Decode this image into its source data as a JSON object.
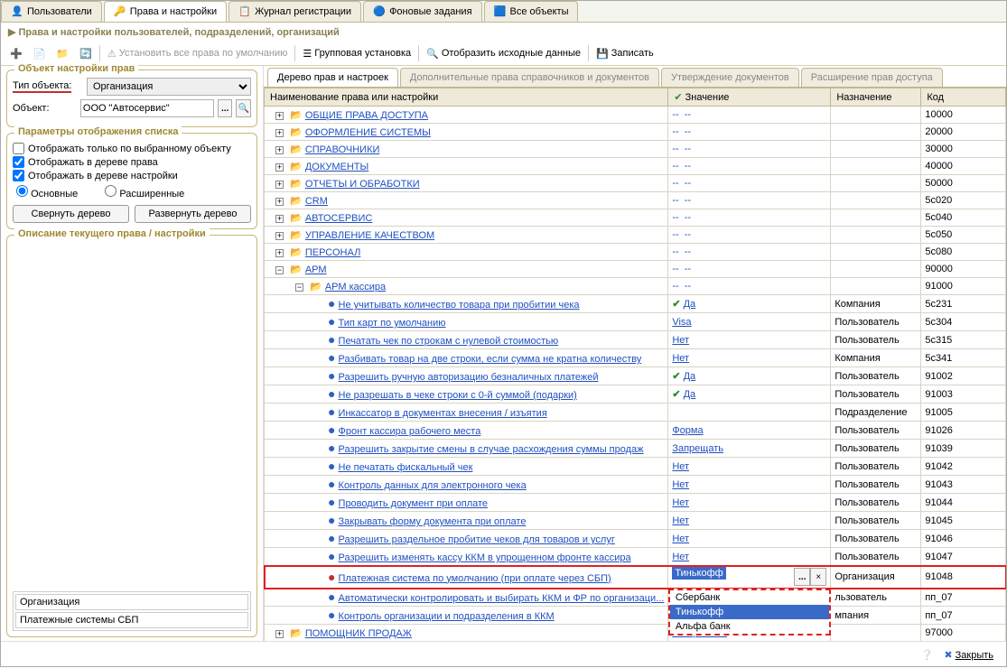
{
  "top_tabs": {
    "users": "Пользователи",
    "rights": "Права и настройки",
    "log": "Журнал регистрации",
    "jobs": "Фоновые задания",
    "all": "Все объекты"
  },
  "breadcrumb": "Права и настройки пользователей, подразделений, организаций",
  "toolbar": {
    "set_defaults": "Установить все права по умолчанию",
    "group_set": "Групповая установка",
    "show_source": "Отобразить исходные данные",
    "save": "Записать"
  },
  "left": {
    "section1_title": "Объект настройки прав",
    "type_label": "Тип объекта:",
    "type_value": "Организация",
    "object_label": "Объект:",
    "object_value": "ООО \"Автосервис\"",
    "section2_title": "Параметры отображения списка",
    "chk_only_selected": "Отображать только по  выбранному объекту",
    "chk_show_rights": "Отображать в дереве права",
    "chk_show_settings": "Отображать в дереве настройки",
    "radio_main": "Основные",
    "radio_ext": "Расширенные",
    "btn_collapse": "Свернуть дерево",
    "btn_expand": "Развернуть дерево",
    "section3_title": "Описание текущего права / настройки",
    "desc_col1": "Организация",
    "desc_col2": "Платежные системы СБП"
  },
  "mid_tabs": {
    "tree": "Дерево прав и настроек",
    "extra": "Дополнительные права справочников и документов",
    "approve": "Утверждение документов",
    "expand": "Расширение прав доступа"
  },
  "grid_headers": {
    "name": "Наименование права или настройки",
    "value": "Значение",
    "assign": "Назначение",
    "code": "Код"
  },
  "rows": [
    {
      "type": "folder",
      "level": 0,
      "name": "ОБЩИЕ ПРАВА ДОСТУПА",
      "val": "-- --",
      "assign": "",
      "code": "10000"
    },
    {
      "type": "folder",
      "level": 0,
      "name": "ОФОРМЛЕНИЕ СИСТЕМЫ",
      "val": "-- --",
      "assign": "",
      "code": "20000"
    },
    {
      "type": "folder",
      "level": 0,
      "name": "СПРАВОЧНИКИ",
      "val": "-- --",
      "assign": "",
      "code": "30000"
    },
    {
      "type": "folder",
      "level": 0,
      "name": "ДОКУМЕНТЫ",
      "val": "-- --",
      "assign": "",
      "code": "40000"
    },
    {
      "type": "folder",
      "level": 0,
      "name": "ОТЧЕТЫ И ОБРАБОТКИ",
      "val": "-- --",
      "assign": "",
      "code": "50000"
    },
    {
      "type": "folder",
      "level": 0,
      "name": "CRM",
      "val": "-- --",
      "assign": "",
      "code": "5с020"
    },
    {
      "type": "folder",
      "level": 0,
      "name": "АВТОСЕРВИС",
      "val": "-- --",
      "assign": "",
      "code": "5с040"
    },
    {
      "type": "folder",
      "level": 0,
      "name": "УПРАВЛЕНИЕ КАЧЕСТВОМ",
      "val": "-- --",
      "assign": "",
      "code": "5с050"
    },
    {
      "type": "folder",
      "level": 0,
      "name": "ПЕРСОНАЛ",
      "val": "-- --",
      "assign": "",
      "code": "5с080"
    },
    {
      "type": "folder",
      "level": 0,
      "name": "АРМ",
      "val": "-- --",
      "assign": "",
      "code": "90000",
      "open": true
    },
    {
      "type": "folder",
      "level": 1,
      "name": "АРМ кассира",
      "val": "-- --",
      "assign": "",
      "code": "91000",
      "open": true
    },
    {
      "type": "leaf",
      "level": 2,
      "name": "Не учитывать количество товара при пробитии чека",
      "val": "Да",
      "check": true,
      "assign": "Компания",
      "code": "5с231"
    },
    {
      "type": "leaf",
      "level": 2,
      "name": "Тип карт по умолчанию",
      "val": "Visa",
      "assign": "Пользователь",
      "code": "5с304"
    },
    {
      "type": "leaf",
      "level": 2,
      "name": "Печатать чек по строкам с нулевой стоимостью",
      "val": "Нет",
      "assign": "Пользователь",
      "code": "5с315"
    },
    {
      "type": "leaf",
      "level": 2,
      "name": "Разбивать товар на две строки, если сумма не кратна количеству",
      "val": "Нет",
      "assign": "Компания",
      "code": "5с341"
    },
    {
      "type": "leaf",
      "level": 2,
      "name": "Разрешить ручную авторизацию безналичных платежей",
      "val": "Да",
      "check": true,
      "assign": "Пользователь",
      "code": "91002"
    },
    {
      "type": "leaf",
      "level": 2,
      "name": "Не разрешать в чеке строки с 0-й суммой (подарки)",
      "val": "Да",
      "check": true,
      "assign": "Пользователь",
      "code": "91003"
    },
    {
      "type": "leaf",
      "level": 2,
      "name": "Инкассатор в документах внесения / изъятия",
      "val": "",
      "assign": "Подразделение",
      "code": "91005"
    },
    {
      "type": "leaf",
      "level": 2,
      "name": "Фронт кассира рабочего места",
      "val": "Форма",
      "assign": "Пользователь",
      "code": "91026"
    },
    {
      "type": "leaf",
      "level": 2,
      "name": "Разрешить закрытие смены в случае расхождения суммы продаж",
      "val": "Запрещать",
      "assign": "Пользователь",
      "code": "91039"
    },
    {
      "type": "leaf",
      "level": 2,
      "name": "Не печатать фискальный чек",
      "val": "Нет",
      "assign": "Пользователь",
      "code": "91042"
    },
    {
      "type": "leaf",
      "level": 2,
      "name": "Контроль данных для электронного чека",
      "val": "Нет",
      "assign": "Пользователь",
      "code": "91043"
    },
    {
      "type": "leaf",
      "level": 2,
      "name": "Проводить документ при оплате",
      "val": "Нет",
      "assign": "Пользователь",
      "code": "91044"
    },
    {
      "type": "leaf",
      "level": 2,
      "name": "Закрывать форму документа при оплате",
      "val": "Нет",
      "assign": "Пользователь",
      "code": "91045"
    },
    {
      "type": "leaf",
      "level": 2,
      "name": "Разрешить раздельное пробитие чеков для товаров и услуг",
      "val": "Нет",
      "assign": "Пользователь",
      "code": "91046"
    },
    {
      "type": "leaf",
      "level": 2,
      "name": "Разрешить изменять кассу ККМ в упрощенном фронте кассира",
      "val": "Нет",
      "assign": "Пользователь",
      "code": "91047"
    },
    {
      "type": "leaf",
      "level": 2,
      "name": "Платежная система по умолчанию (при оплате через СБП)",
      "val": "Тинькофф",
      "assign": "Организация",
      "code": "91048",
      "highlight": true,
      "red": true,
      "editing": true
    },
    {
      "type": "leaf",
      "level": 2,
      "name": "Автоматически контролировать и выбирать ККМ и ФР по организаци...",
      "val": "Сбербанк",
      "check": true,
      "assign": "льзователь",
      "code": "пп_07"
    },
    {
      "type": "leaf",
      "level": 2,
      "name": "Контроль организации и подразделения в ККМ",
      "val": "Тинькофф",
      "assign": "мпания",
      "code": "пп_07"
    },
    {
      "type": "folder",
      "level": 0,
      "name": "ПОМОЩНИК ПРОДАЖ",
      "val": "Альфа банк",
      "assign": "",
      "code": "97000"
    }
  ],
  "dropdown": {
    "items": [
      "Сбербанк",
      "Тинькофф",
      "Альфа банк"
    ],
    "selected": "Тинькофф"
  },
  "bottom": {
    "close": "Закрыть"
  }
}
